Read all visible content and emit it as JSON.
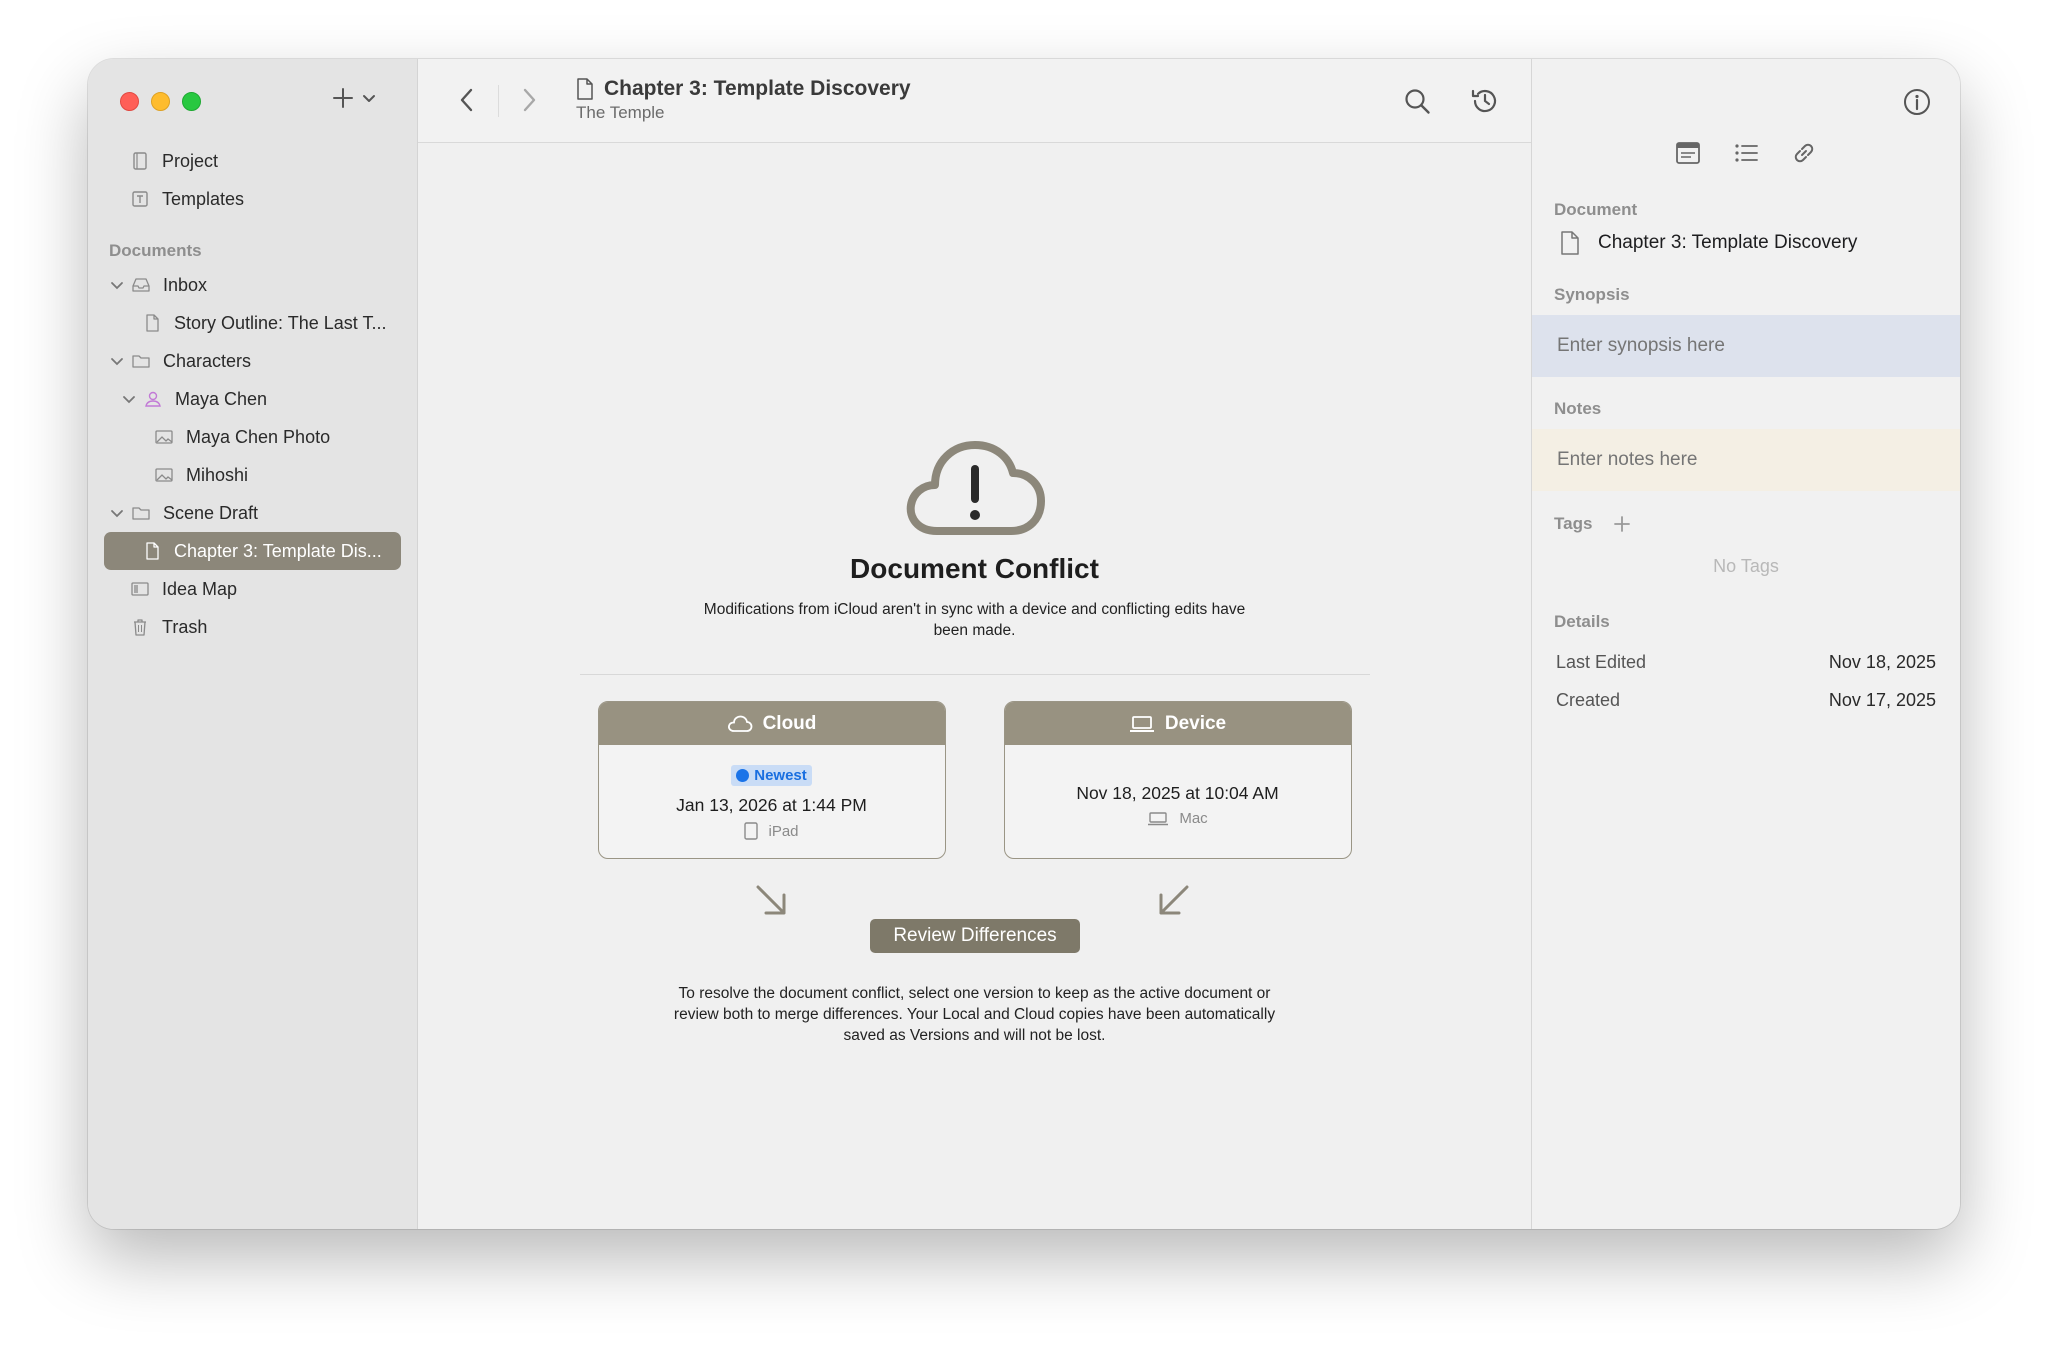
{
  "sidebar": {
    "top_items": [
      {
        "label": "Project",
        "icon": "project-book-icon"
      },
      {
        "label": "Templates",
        "icon": "template-icon"
      }
    ],
    "section_header": "Documents",
    "tree": [
      {
        "label": "Inbox",
        "icon": "inbox-tray-icon",
        "level": 0,
        "expanded": true
      },
      {
        "label": "Story Outline: The Last T...",
        "icon": "document-icon",
        "level": 1
      },
      {
        "label": "Characters",
        "icon": "folder-icon",
        "level": 0,
        "expanded": true
      },
      {
        "label": "Maya Chen",
        "icon": "person-icon",
        "level": 1,
        "expanded": true
      },
      {
        "label": "Maya Chen Photo",
        "icon": "image-icon",
        "level": 2
      },
      {
        "label": "Mihoshi",
        "icon": "image-icon",
        "level": 2
      },
      {
        "label": "Scene Draft",
        "icon": "folder-icon",
        "level": 0,
        "expanded": true
      },
      {
        "label": "Chapter 3: Template Dis...",
        "icon": "document-icon",
        "level": 1,
        "selected": true
      },
      {
        "label": "Idea Map",
        "icon": "map-icon",
        "level": 0
      },
      {
        "label": "Trash",
        "icon": "trash-icon",
        "level": 0
      }
    ]
  },
  "toolbar": {
    "title": "Chapter 3: Template Discovery",
    "subtitle": "The Temple"
  },
  "conflict": {
    "title": "Document Conflict",
    "description": "Modifications from iCloud aren't in sync with a device and conflicting edits have been made.",
    "cloud": {
      "header": "Cloud",
      "badge": "Newest",
      "date": "Jan 13, 2026 at 1:44 PM",
      "device": "iPad"
    },
    "device": {
      "header": "Device",
      "date": "Nov 18, 2025 at 10:04 AM",
      "device": "Mac"
    },
    "review_label": "Review Differences",
    "resolve_lines": [
      "To resolve the document conflict, select one version to keep as the active document or",
      "review both to merge differences. Your Local and Cloud copies have been automatically",
      "saved as Versions and will not be lost."
    ]
  },
  "inspector": {
    "document_label": "Document",
    "document_name": "Chapter 3: Template Discovery",
    "synopsis_label": "Synopsis",
    "synopsis_placeholder": "Enter synopsis here",
    "notes_label": "Notes",
    "notes_placeholder": "Enter notes here",
    "tags_label": "Tags",
    "no_tags": "No Tags",
    "details_label": "Details",
    "details": [
      {
        "key": "Last Edited",
        "value": "Nov 18, 2025"
      },
      {
        "key": "Created",
        "value": "Nov 17, 2025"
      }
    ]
  },
  "colors": {
    "accent": "#8c877a",
    "card_header": "#989281",
    "review_button": "#7e7969",
    "badge_bg": "#c9dcf6",
    "badge_text": "#1a6fe0"
  }
}
